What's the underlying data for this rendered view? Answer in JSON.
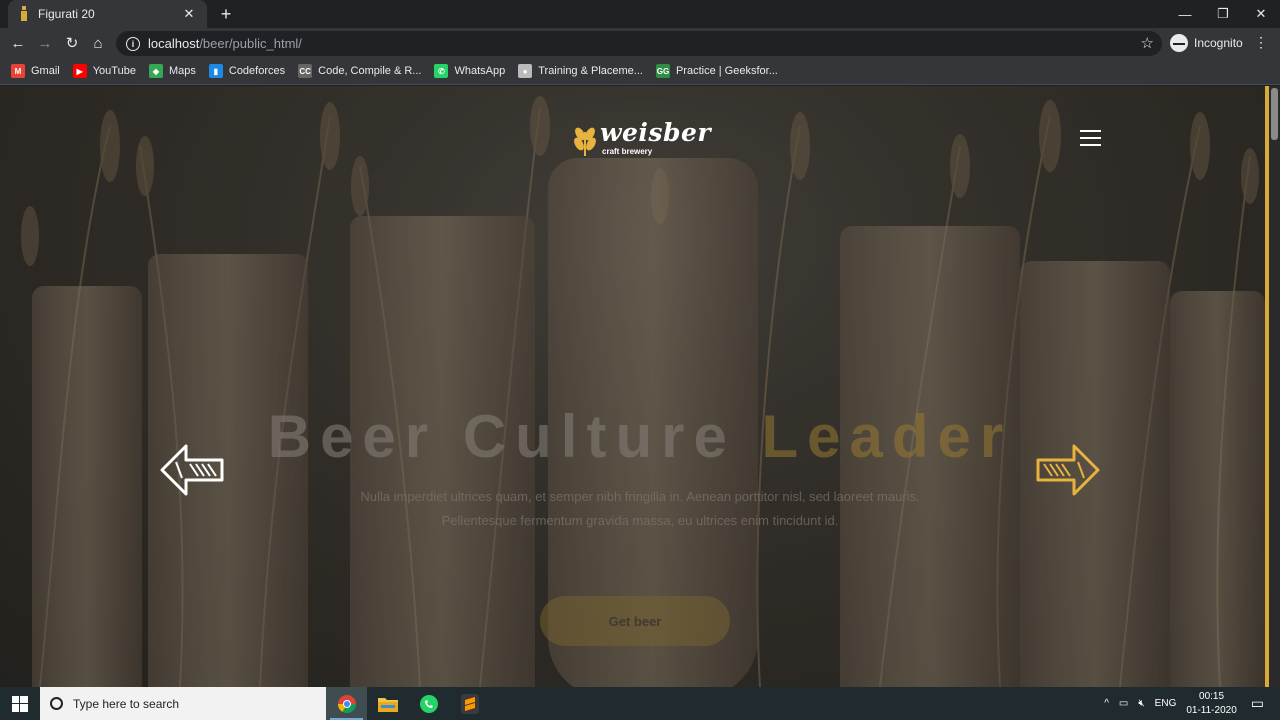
{
  "browser": {
    "tab": {
      "title": "Figurati 20",
      "close": "✕"
    },
    "new_tab": "+",
    "window": {
      "minimize": "—",
      "maximize": "❐",
      "close": "✕"
    },
    "nav": {
      "back": "←",
      "forward": "→",
      "reload": "↻",
      "home": "⌂"
    },
    "url": {
      "host": "localhost",
      "path": "/beer/public_html/"
    },
    "star": "☆",
    "incognito_label": "Incognito",
    "menu": "⋮",
    "bookmarks": [
      {
        "label": "Gmail",
        "icon": "gmail-icon",
        "color": "#ea4335",
        "glyph": "M"
      },
      {
        "label": "YouTube",
        "icon": "youtube-icon",
        "color": "#ff0000",
        "glyph": "▶"
      },
      {
        "label": "Maps",
        "icon": "maps-icon",
        "color": "#34a853",
        "glyph": "◆"
      },
      {
        "label": "Codeforces",
        "icon": "codeforces-icon",
        "color": "#1e88e5",
        "glyph": "▮"
      },
      {
        "label": "Code, Compile & R...",
        "icon": "compiler-icon",
        "color": "#666666",
        "glyph": "CC"
      },
      {
        "label": "WhatsApp",
        "icon": "whatsapp-icon",
        "color": "#25d366",
        "glyph": "✆"
      },
      {
        "label": "Training & Placeme...",
        "icon": "training-icon",
        "color": "#bbbbbb",
        "glyph": "●"
      },
      {
        "label": "Practice | Geeksfor...",
        "icon": "gfg-icon",
        "color": "#2f8d46",
        "glyph": "GG"
      }
    ]
  },
  "page": {
    "logo": {
      "wordmark": "weisber",
      "tagline": "craft brewery"
    },
    "headline": {
      "part1": "Beer Culture",
      "part2": "Leader"
    },
    "description": "Nulla imperdiet ultrices quam, et semper nibh fringilla in. Aenean porttitor nisl, sed laoreet mauris. Pellentesque fermentum gravida massa, eu ultrices enim tincidunt id.",
    "cta_label": "Get beer",
    "colors": {
      "accent": "#e8b23f",
      "arrow_left": "#ffffff",
      "arrow_right": "#e8b23f"
    }
  },
  "taskbar": {
    "search_placeholder": "Type here to search",
    "apps": [
      "chrome-icon",
      "file-explorer-icon",
      "whatsapp-icon",
      "sublime-text-icon"
    ],
    "tray": {
      "chevron": "^",
      "lang": "ENG",
      "time": "00:15",
      "date": "01-11-2020"
    }
  }
}
